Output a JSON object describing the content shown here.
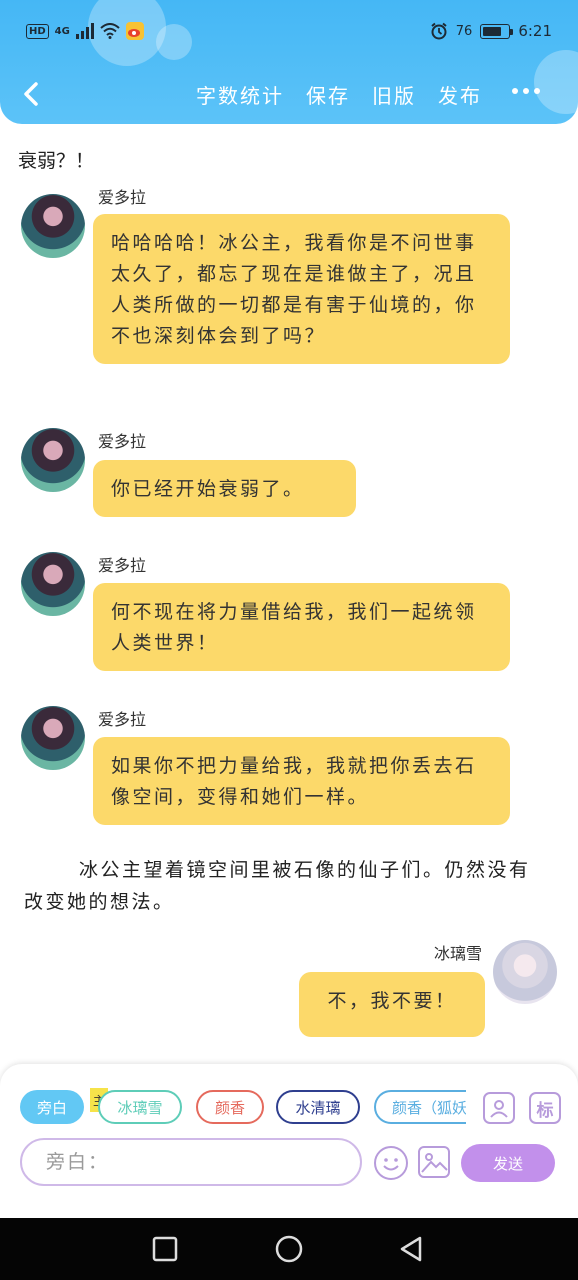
{
  "status_bar": {
    "hd_badge": "HD",
    "network": "4G",
    "battery_level": "76",
    "battery_fraction": 0.76,
    "time": "6:21"
  },
  "toolbar": {
    "word_count": "字数统计",
    "save": "保存",
    "old_version": "旧版",
    "publish": "发布"
  },
  "chat": {
    "narration_top": "衰弱？！",
    "messages": [
      {
        "speaker": "爱多拉",
        "text": "哈哈哈哈！冰公主，我看你是不问世事太久了，都忘了现在是谁做主了，况且人类所做的一切都是有害于仙境的，你不也深刻体会到了吗？"
      },
      {
        "speaker": "爱多拉",
        "text": "你已经开始衰弱了。"
      },
      {
        "speaker": "爱多拉",
        "text": "何不现在将力量借给我，我们一起统领人类世界！"
      },
      {
        "speaker": "爱多拉",
        "text": "如果你不把力量给我，我就把你丢去石像空间，变得和她们一样。"
      }
    ],
    "narration": "冰公主望着镜空间里被石像的仙子们。仍然没有改变她的想法。",
    "reply": {
      "speaker": "冰璃雪",
      "text": "不，我不要！"
    }
  },
  "composer": {
    "roles": [
      {
        "label": "旁白",
        "color": "#62c8f4"
      },
      {
        "label": "冰璃雪",
        "color": "#5ecdb8"
      },
      {
        "label": "颜香",
        "color": "#e56a5d"
      },
      {
        "label": "水清璃",
        "color": "#2f3f8f"
      },
      {
        "label": "颜香（狐妖",
        "color": "#5aaee0"
      }
    ],
    "main_tag": "主",
    "mark_label": "标",
    "input_placeholder": "旁白：",
    "send_label": "发送"
  }
}
